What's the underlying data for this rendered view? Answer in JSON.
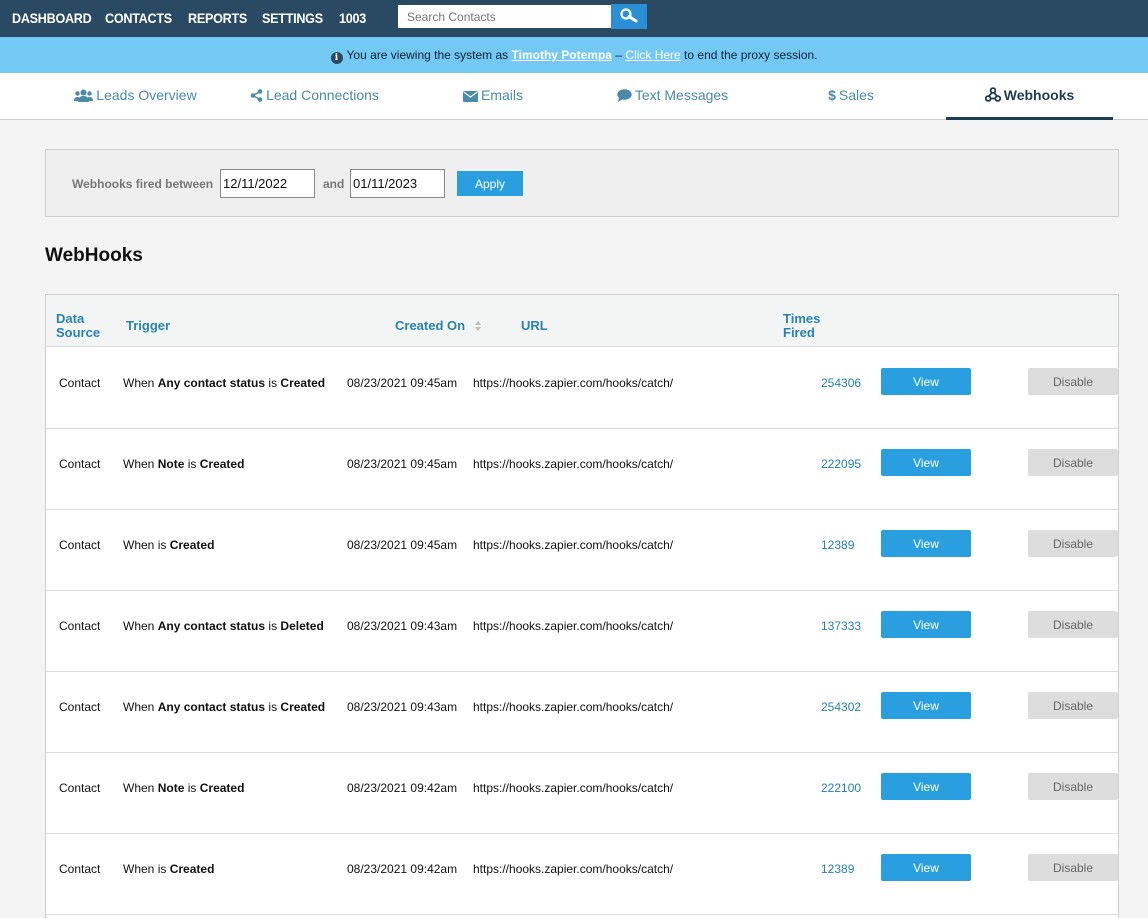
{
  "nav": {
    "items": [
      "DASHBOARD",
      "CONTACTS",
      "REPORTS",
      "SETTINGS",
      "1003"
    ],
    "search_placeholder": "Search Contacts"
  },
  "banner": {
    "prefix": "You are viewing the system as",
    "user": "Timothy Potempa",
    "dash": "–",
    "link": "Click Here",
    "suffix": "to end the proxy session."
  },
  "tabs": [
    {
      "label": "Leads Overview",
      "icon": "users-icon"
    },
    {
      "label": "Lead Connections",
      "icon": "share-icon"
    },
    {
      "label": "Emails",
      "icon": "envelope-icon"
    },
    {
      "label": "Text Messages",
      "icon": "chat-bubble-icon"
    },
    {
      "label": "Sales",
      "icon": "dollar-icon"
    },
    {
      "label": "Webhooks",
      "icon": "webhook-icon"
    }
  ],
  "filter": {
    "label": "Webhooks fired between",
    "start": "12/11/2022",
    "and": "and",
    "end": "01/11/2023",
    "apply": "Apply"
  },
  "section_title": "WebHooks",
  "table": {
    "headers": {
      "data_source_1": "Data",
      "data_source_2": "Source",
      "trigger": "Trigger",
      "created_on": "Created On",
      "url": "URL",
      "times_fired_1": "Times",
      "times_fired_2": "Fired"
    },
    "view_label": "View",
    "disable_label": "Disable",
    "rows": [
      {
        "source": "Contact",
        "pre": "When",
        "subject": "Any contact status",
        "is": "is",
        "event": "Created",
        "date": "08/23/2021 09:45am",
        "url": "https://hooks.zapier.com/hooks/catch/",
        "fired": "254306"
      },
      {
        "source": "Contact",
        "pre": "When",
        "subject": "Note",
        "is": "is",
        "event": "Created",
        "date": "08/23/2021 09:45am",
        "url": "https://hooks.zapier.com/hooks/catch/",
        "fired": "222095"
      },
      {
        "source": "Contact",
        "pre": "When",
        "subject": "",
        "is": "is",
        "event": "Created",
        "date": "08/23/2021 09:45am",
        "url": "https://hooks.zapier.com/hooks/catch/",
        "fired": "12389"
      },
      {
        "source": "Contact",
        "pre": "When",
        "subject": "Any contact status",
        "is": "is",
        "event": "Deleted",
        "date": "08/23/2021 09:43am",
        "url": "https://hooks.zapier.com/hooks/catch/",
        "fired": "137333"
      },
      {
        "source": "Contact",
        "pre": "When",
        "subject": "Any contact status",
        "is": "is",
        "event": "Created",
        "date": "08/23/2021 09:43am",
        "url": "https://hooks.zapier.com/hooks/catch/",
        "fired": "254302"
      },
      {
        "source": "Contact",
        "pre": "When",
        "subject": "Note",
        "is": "is",
        "event": "Created",
        "date": "08/23/2021 09:42am",
        "url": "https://hooks.zapier.com/hooks/catch/",
        "fired": "222100"
      },
      {
        "source": "Contact",
        "pre": "When",
        "subject": "",
        "is": "is",
        "event": "Created",
        "date": "08/23/2021 09:42am",
        "url": "https://hooks.zapier.com/hooks/catch/",
        "fired": "12389"
      }
    ]
  }
}
